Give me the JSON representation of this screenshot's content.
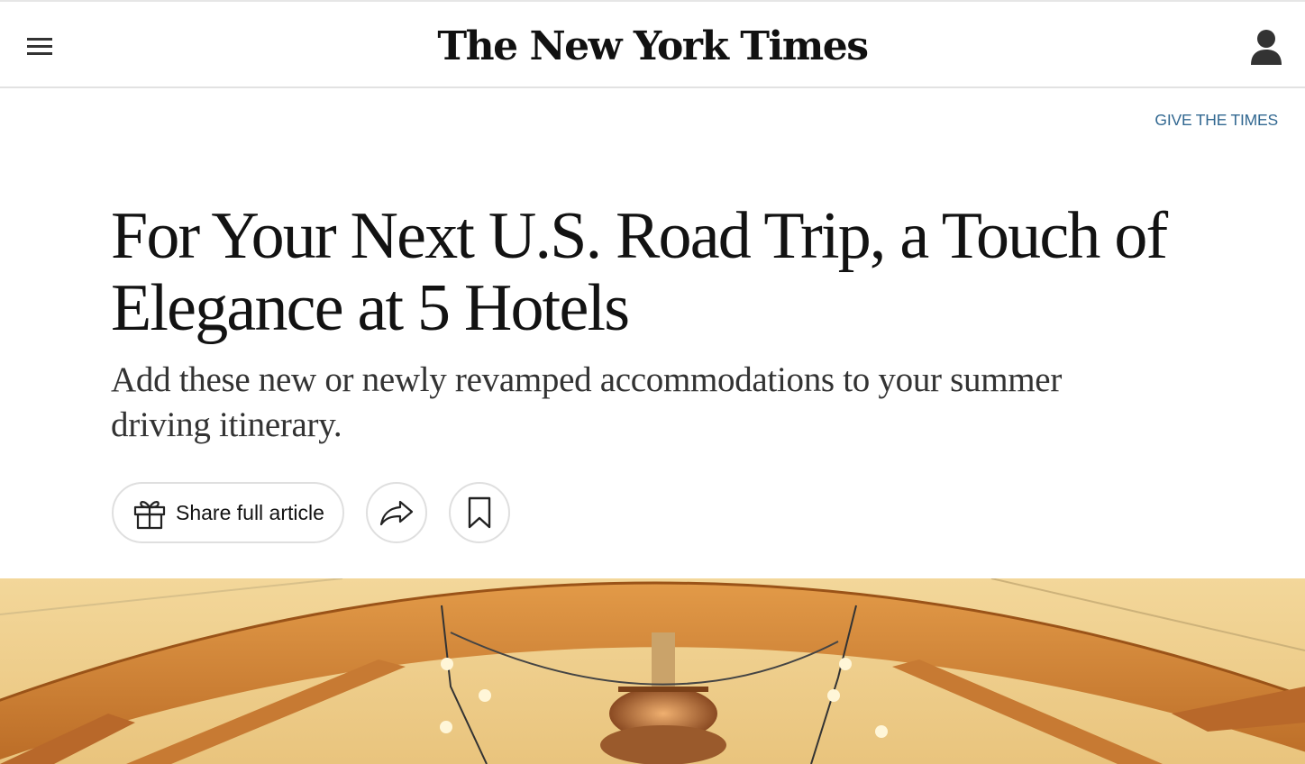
{
  "header": {
    "menu_icon": "hamburger-menu-icon",
    "masthead": "The New York Times",
    "account_icon": "user-account-icon"
  },
  "promo": {
    "give_link": "GIVE THE TIMES"
  },
  "article": {
    "headline_line1": "For Your Next U.S. Road Trip, a Touch of",
    "headline_line2": "Elegance at 5 Hotels",
    "summary": "Add these new or newly revamped accommodations to your summer driving itinerary."
  },
  "tools": {
    "share_label": "Share full article",
    "share_icon": "gift-icon",
    "forward_icon": "share-arrow-icon",
    "save_icon": "bookmark-icon"
  },
  "colors": {
    "link": "#326891",
    "text": "#121212",
    "border": "#dfdfdf",
    "wood": "#c8782e"
  }
}
